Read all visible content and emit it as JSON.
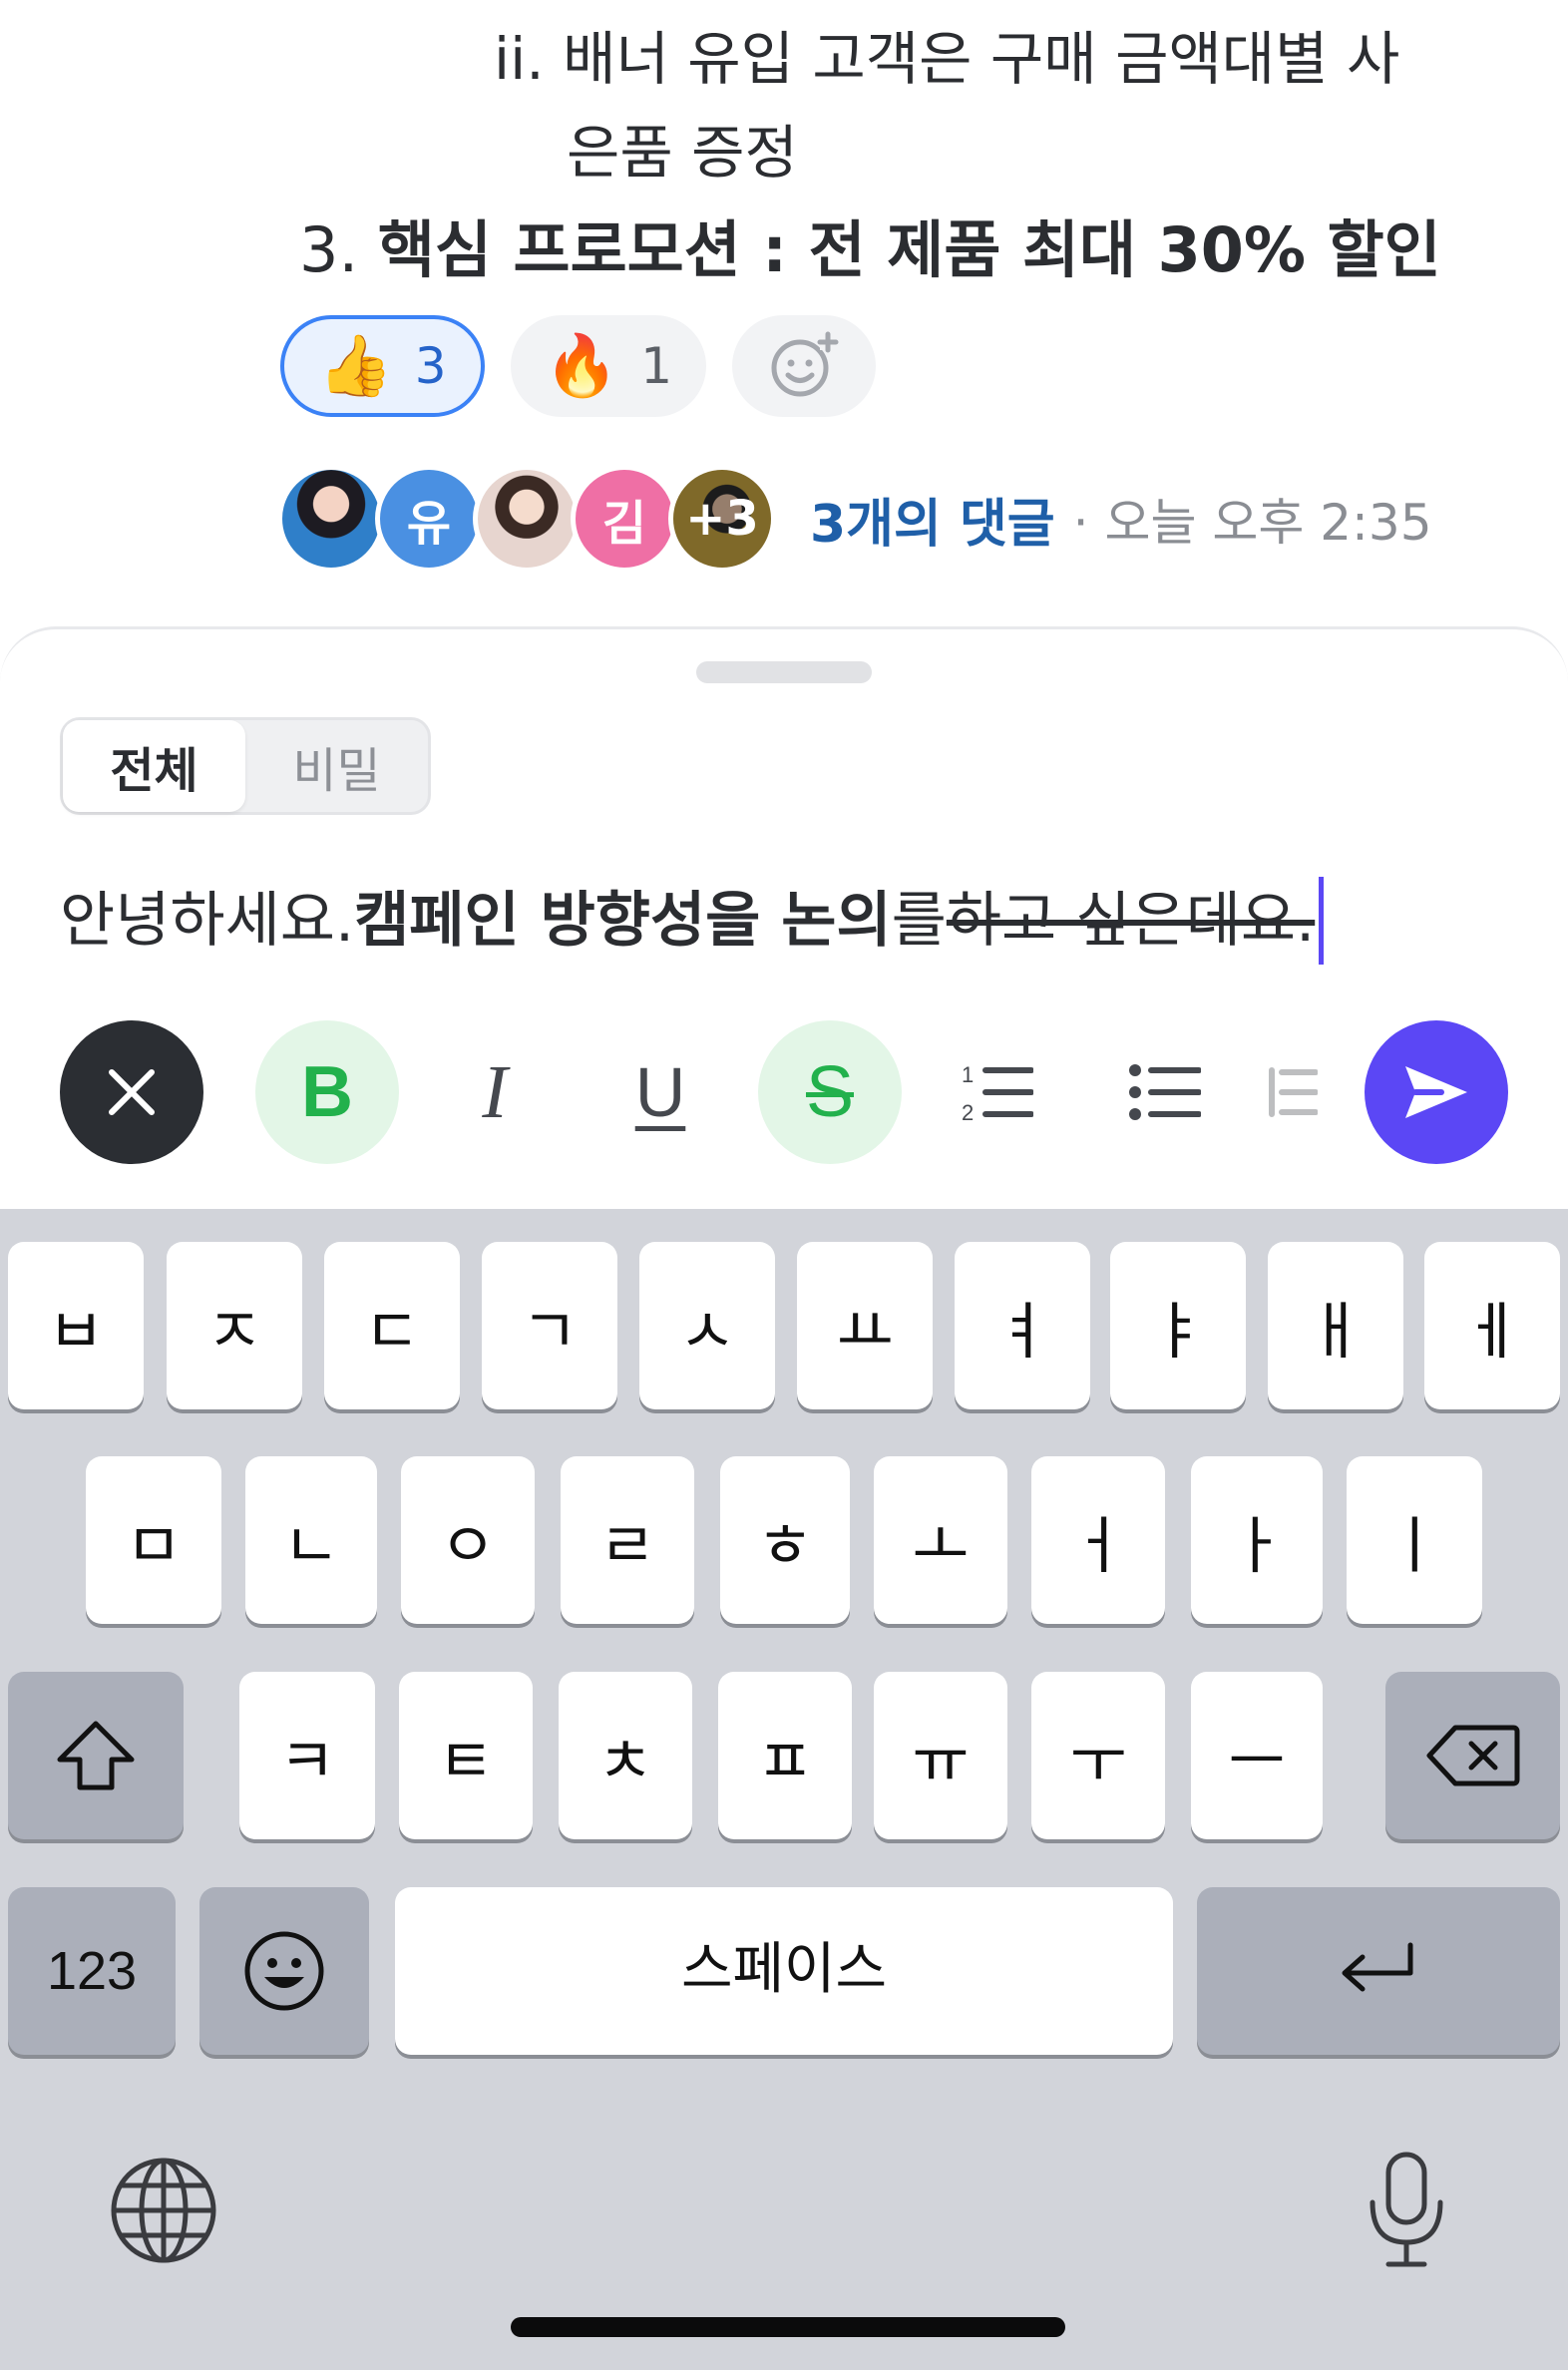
{
  "message": {
    "line1": "ii. 배너 유입 고객은 구매 금액대별 사",
    "line2": "은품 증정",
    "line3_num": "3. ",
    "line3_bold": "핵심 프로모션 : 전 제품 최대 30% 할인"
  },
  "reactions": [
    {
      "emoji": "👍",
      "count": "3",
      "icon": "thumbs-up-icon",
      "active": true
    },
    {
      "emoji": "🔥",
      "count": "1",
      "icon": "fire-icon",
      "active": false
    }
  ],
  "add_reaction_icon": "add-emoji-icon",
  "comments": {
    "avatars": [
      {
        "label": "",
        "kind": "photo"
      },
      {
        "label": "유",
        "kind": "initial",
        "color": "#4a90e2"
      },
      {
        "label": "",
        "kind": "photo"
      },
      {
        "label": "김",
        "kind": "initial",
        "color": "#ef6fa5"
      },
      {
        "label": "+3",
        "kind": "photo-overflow"
      }
    ],
    "count_label": "3개의 댓글",
    "time_label": "· 오늘 오후 2:35"
  },
  "composer": {
    "tabs": [
      {
        "label": "전체",
        "selected": true
      },
      {
        "label": "비밀",
        "selected": false
      }
    ],
    "text_plain_1": "안녕하세요. ",
    "text_bold": "캠페인 방향성을 논의",
    "text_plain_2": "를 ",
    "text_strike": "하고 싶은데요."
  },
  "toolbar": {
    "close_icon": "close-icon",
    "bold_label": "B",
    "italic_label": "I",
    "underline_label": "U",
    "strike_label": "S",
    "ordered_list_icon": "ordered-list-icon",
    "unordered_list_icon": "bullet-list-icon",
    "more_icon": "indent-icon",
    "send_icon": "send-icon",
    "active_color": "#22b14c",
    "send_color": "#5b47f5"
  },
  "keyboard": {
    "row1": [
      "ㅂ",
      "ㅈ",
      "ㄷ",
      "ㄱ",
      "ㅅ",
      "ㅛ",
      "ㅕ",
      "ㅑ",
      "ㅐ",
      "ㅔ"
    ],
    "row2": [
      "ㅁ",
      "ㄴ",
      "ㅇ",
      "ㄹ",
      "ㅎ",
      "ㅗ",
      "ㅓ",
      "ㅏ",
      "ㅣ"
    ],
    "row3": [
      "ㅋ",
      "ㅌ",
      "ㅊ",
      "ㅍ",
      "ㅠ",
      "ㅜ",
      "ㅡ"
    ],
    "numbers_label": "123",
    "space_label": "스페이스",
    "shift_icon": "shift-icon",
    "backspace_icon": "backspace-icon",
    "emoji_icon": "emoji-icon",
    "return_icon": "return-icon",
    "globe_icon": "globe-icon",
    "mic_icon": "microphone-icon"
  }
}
